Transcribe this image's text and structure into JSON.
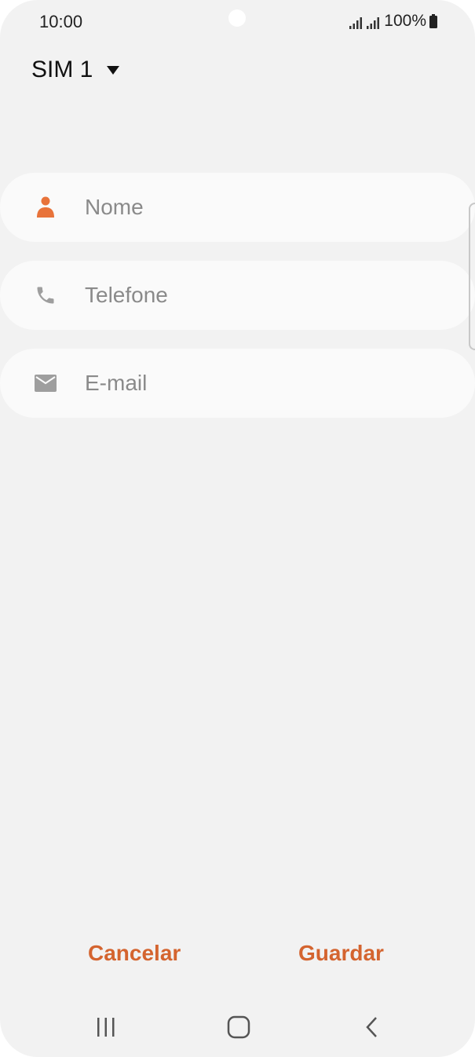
{
  "status_bar": {
    "time": "10:00",
    "battery_text": "100%",
    "icons": [
      "signal-icon",
      "signal-icon",
      "battery-icon"
    ]
  },
  "sim_selector": {
    "label": "SIM 1",
    "icon": "caret-down-icon"
  },
  "form": {
    "fields": [
      {
        "placeholder": "Nome",
        "value": "",
        "icon": "person-icon",
        "icon_color": "#e8733a"
      },
      {
        "placeholder": "Telefone",
        "value": "",
        "icon": "phone-icon",
        "icon_color": "#9e9e9e"
      },
      {
        "placeholder": "E-mail",
        "value": "",
        "icon": "mail-icon",
        "icon_color": "#9e9e9e"
      }
    ]
  },
  "actions": {
    "cancel_label": "Cancelar",
    "save_label": "Guardar",
    "accent_color": "#d4642f"
  },
  "nav_bar": {
    "buttons": [
      "recents-icon",
      "home-icon",
      "back-icon"
    ]
  }
}
